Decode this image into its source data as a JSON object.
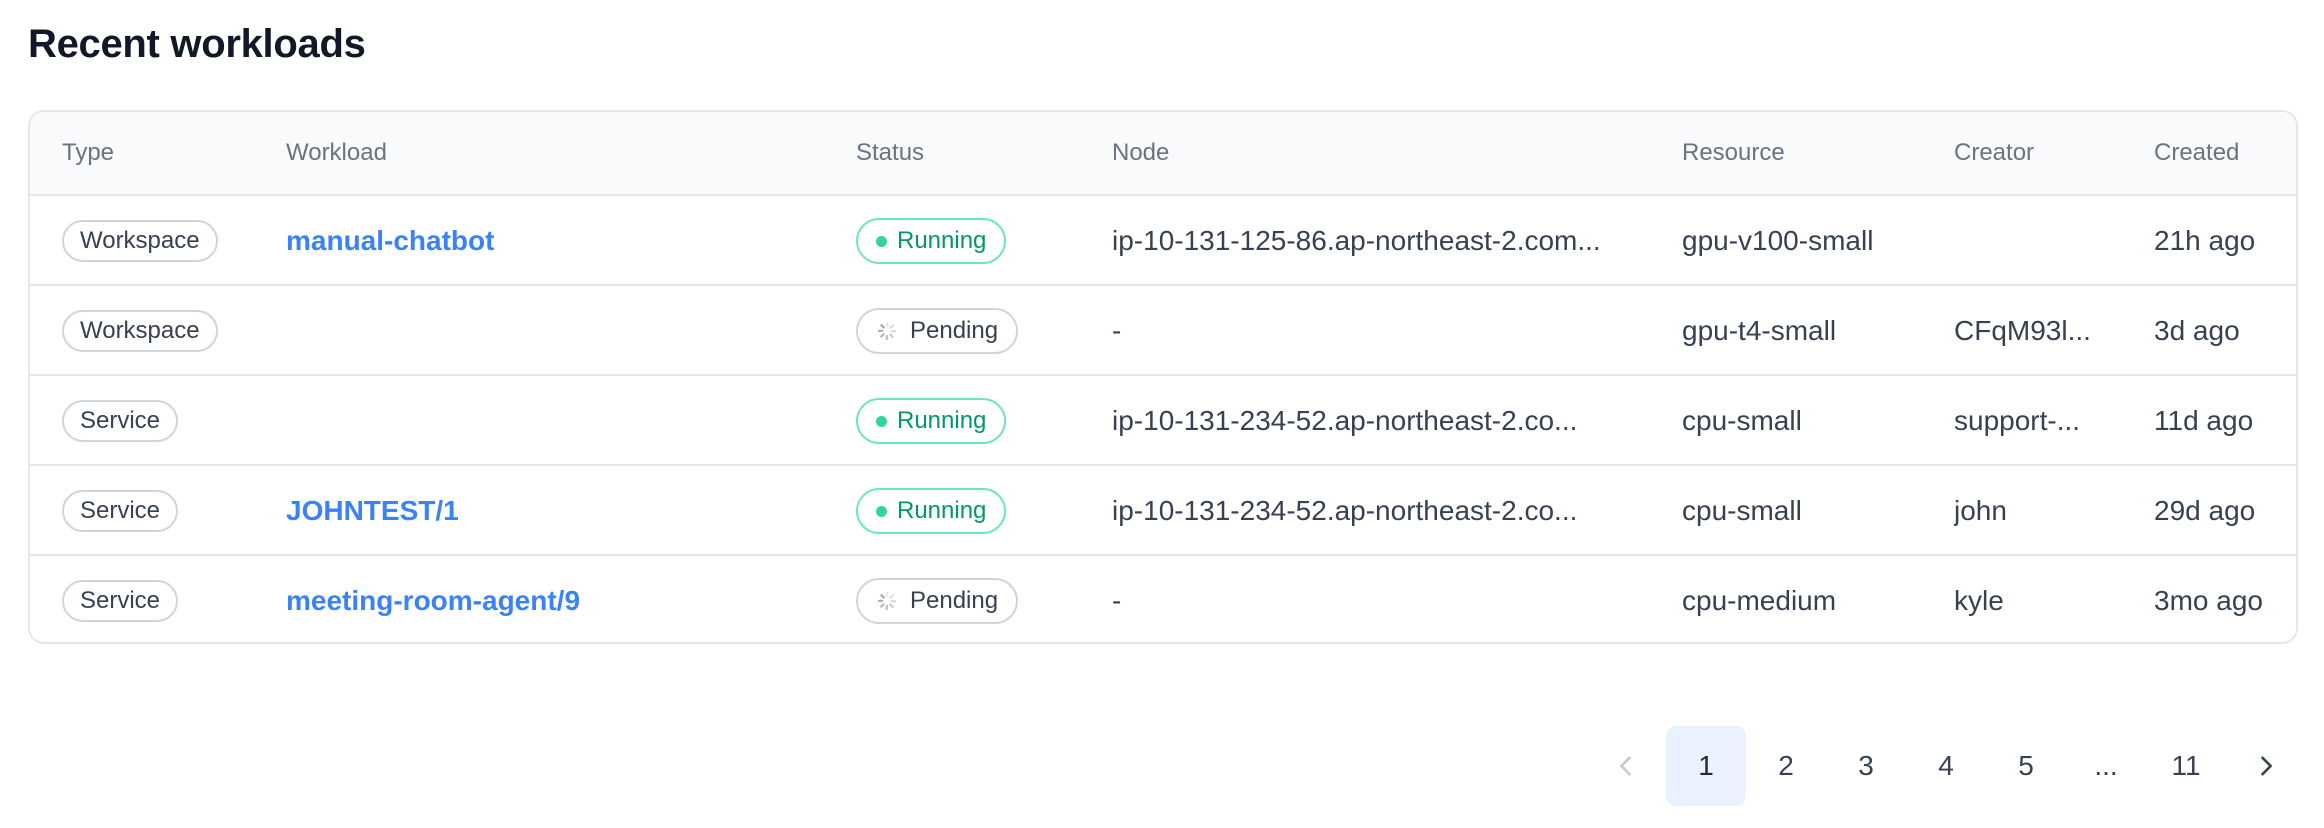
{
  "page": {
    "title": "Recent workloads"
  },
  "table": {
    "headers": {
      "type": "Type",
      "workload": "Workload",
      "status": "Status",
      "node": "Node",
      "resource": "Resource",
      "creator": "Creator",
      "created": "Created"
    },
    "rows": [
      {
        "type": "Workspace",
        "workload": "manual-chatbot",
        "status": "Running",
        "node": "ip-10-131-125-86.ap-northeast-2.com...",
        "resource": "gpu-v100-small",
        "creator": "",
        "created": "21h ago"
      },
      {
        "type": "Workspace",
        "workload": "",
        "status": "Pending",
        "node": "-",
        "resource": "gpu-t4-small",
        "creator": "CFqM93l...",
        "created": "3d ago"
      },
      {
        "type": "Service",
        "workload": "",
        "status": "Running",
        "node": "ip-10-131-234-52.ap-northeast-2.co...",
        "resource": "cpu-small",
        "creator": "support-...",
        "created": "11d ago"
      },
      {
        "type": "Service",
        "workload": "JOHNTEST/1",
        "status": "Running",
        "node": "ip-10-131-234-52.ap-northeast-2.co...",
        "resource": "cpu-small",
        "creator": "john",
        "created": "29d ago"
      },
      {
        "type": "Service",
        "workload": "meeting-room-agent/9",
        "status": "Pending",
        "node": "-",
        "resource": "cpu-medium",
        "creator": "kyle",
        "created": "3mo ago"
      }
    ]
  },
  "pagination": {
    "prev_icon": "chevron-left-icon",
    "next_icon": "chevron-right-icon",
    "pages": [
      "1",
      "2",
      "3",
      "4",
      "5",
      "...",
      "11"
    ],
    "current": "1"
  },
  "colors": {
    "link": "#3b82f6",
    "running": "#059669",
    "running_border": "#6ee7b7",
    "active_page_bg": "#eaf1ff"
  }
}
